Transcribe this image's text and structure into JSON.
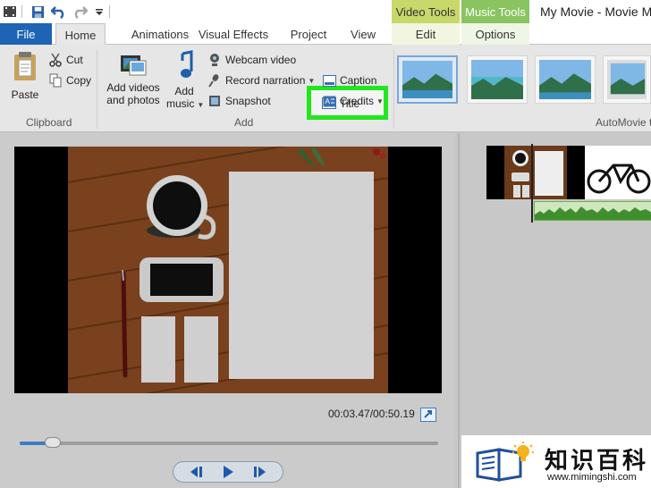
{
  "titlebar": {
    "app_title": "My Movie - Movie Ma",
    "context_video_tools": "Video Tools",
    "context_music_tools": "Music Tools"
  },
  "tabs": {
    "file": "File",
    "home": "Home",
    "animations": "Animations",
    "visual_effects": "Visual Effects",
    "project": "Project",
    "view": "View",
    "edit": "Edit",
    "options": "Options"
  },
  "ribbon": {
    "clipboard": {
      "paste": "Paste",
      "cut": "Cut",
      "copy": "Copy",
      "label": "Clipboard"
    },
    "add": {
      "add_videos_line1": "Add videos",
      "add_videos_line2": "and photos",
      "add_music_line1": "Add",
      "add_music_line2": "music",
      "webcam_video": "Webcam video",
      "record_narration": "Record narration",
      "snapshot": "Snapshot",
      "title": "Title",
      "caption": "Caption",
      "credits": "Credits",
      "label": "Add"
    },
    "automovie": {
      "label": "AutoMovie t"
    }
  },
  "preview": {
    "timecode": "00:03.47/00:50.19",
    "seek_progress": 0.08
  },
  "watermark": {
    "text": "知识百科",
    "url": "www.mimingshi.com"
  },
  "colors": {
    "file_tab": "#1e63b4",
    "video_tools": "#c8d86a",
    "music_tools": "#8ac460",
    "highlight": "#22e61e",
    "seek_fill": "#3d7cc4"
  }
}
